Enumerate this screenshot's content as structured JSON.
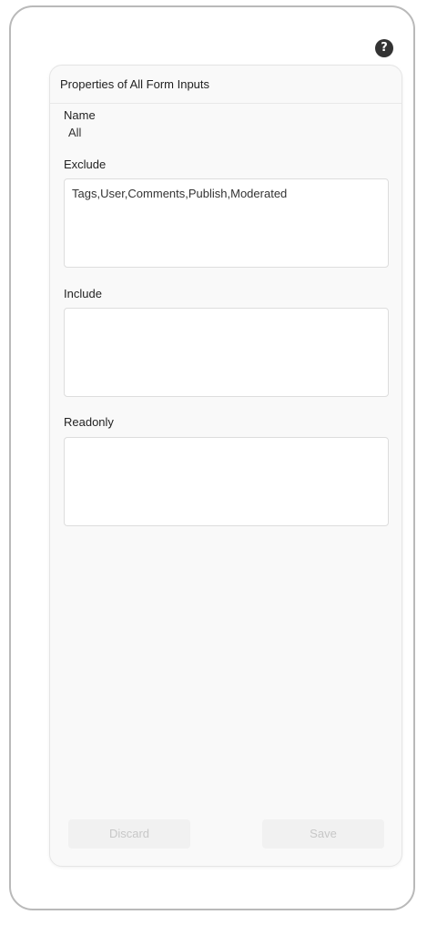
{
  "help": {
    "icon": "question-circle-icon",
    "glyph": "?"
  },
  "panel": {
    "title": "Properties of All Form Inputs",
    "name_label": "Name",
    "name_value": "All",
    "exclude_label": "Exclude",
    "exclude_value": "Tags,User,Comments,Publish,Moderated",
    "include_label": "Include",
    "include_value": "",
    "readonly_label": "Readonly",
    "readonly_value": ""
  },
  "buttons": {
    "discard_label": "Discard",
    "save_label": "Save"
  }
}
